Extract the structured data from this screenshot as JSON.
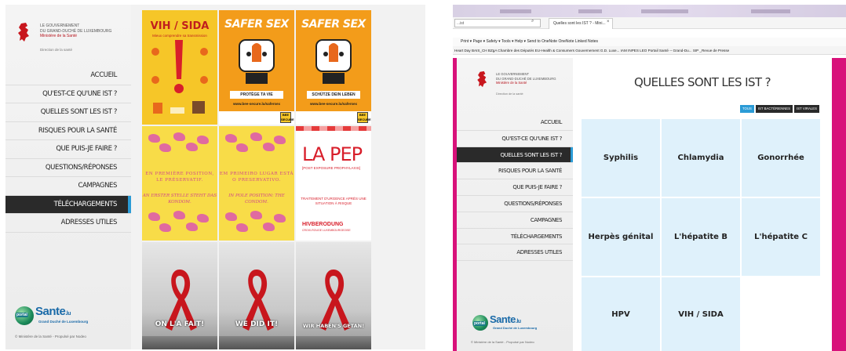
{
  "left": {
    "gov": {
      "line1": "LE GOUVERNEMENT",
      "line2": "DU GRAND-DUCHÉ DE LUXEMBOURG",
      "ministry": "Ministère de la Santé",
      "direction": "Direction de la santé"
    },
    "menu": [
      {
        "label": "ACCUEIL",
        "active": false
      },
      {
        "label": "QU'EST-CE QU'UNE IST ?",
        "active": false
      },
      {
        "label": "QUELLES SONT LES IST ?",
        "active": false
      },
      {
        "label": "RISQUES POUR LA SANTÉ",
        "active": false
      },
      {
        "label": "QUE PUIS-JE FAIRE ?",
        "active": false
      },
      {
        "label": "QUESTIONS/RÉPONSES",
        "active": false
      },
      {
        "label": "CAMPAGNES",
        "active": false
      },
      {
        "label": "TÉLÉCHARGEMENTS",
        "active": true
      },
      {
        "label": "ADRESSES UTILES",
        "active": false
      }
    ],
    "logo": {
      "portal": "portal",
      "name": "Sante",
      "tld": ".lu",
      "sub": "Grand Duché de Luxembourg"
    },
    "copyright": "© Ministère de la Santé - Propulsé par Nodeo",
    "posters": {
      "vih_title": "VIH / SIDA",
      "vih_sub": "Mieux comprendre sa transmission",
      "safer_title": "SAFER SEX",
      "safer1_band": "PROTÈGE TA VIE",
      "safer2_band": "SCHÜTZE DEIN LEBEN",
      "safer_url": "www.bee-secure.lu/safersex",
      "bee": "BEE SECURE",
      "pink1_a": "EN PREMIÈRE POSITION, LE PRÉSERVATIF.",
      "pink1_b": "AN ERSTER STELLE STEHT DAS KONDOM.",
      "pink2_a": "EM PRIMEIRO LUGAR ESTÁ O PRESERVATIVO.",
      "pink2_b": "IN POLE POSITION: THE CONDOM.",
      "pep_title": "LA PEP",
      "pep_sub": "[POST EXPOSURE PROPHYLAXIS]",
      "pep_msg": "TRAITEMENT D'URGENCE APRÈS UNE SITUATION À RISQUE",
      "pep_hb": "HIVBERODUNG",
      "pep_hbs": "CROIX-ROUGE LUXEMBOURGEOISE",
      "rib1": "ON L'A FAIT!",
      "rib2": "WE DID IT!",
      "rib3": "WIR HABEN'S GETAN!"
    }
  },
  "right": {
    "address": "...ist",
    "tab_title": "Quelles sont les IST ? - Mini...",
    "cmd": "Print  ▾  Page ▾  Safety ▾  Tools ▾  Help ▾   Send to OneNote    OneNote Linked Notes",
    "favorites": "Heart Day   BAIS_CH   BZgA   Chambre des Députés   EU-Health & Consumers   Gouvernement G.D. Luxe...   IAM   INPES   LEO   Portail Santé -- Grand-Du...   SIP _Revue de Presse",
    "gov": {
      "line1": "LE GOUVERNEMENT",
      "line2": "DU GRAND-DUCHÉ DE LUXEMBOURG",
      "ministry": "Ministère de la Santé",
      "direction": "Direction de la santé"
    },
    "menu": [
      {
        "label": "ACCUEIL",
        "active": false
      },
      {
        "label": "QU'EST-CE QU'UNE IST ?",
        "active": false
      },
      {
        "label": "QUELLES SONT LES IST ?",
        "active": true
      },
      {
        "label": "RISQUES POUR LA SANTÉ",
        "active": false
      },
      {
        "label": "QUE PUIS-JE FAIRE ?",
        "active": false
      },
      {
        "label": "QUESTIONS/RÉPONSES",
        "active": false
      },
      {
        "label": "CAMPAGNES",
        "active": false
      },
      {
        "label": "TÉLÉCHARGEMENTS",
        "active": false
      },
      {
        "label": "ADRESSES UTILES",
        "active": false
      }
    ],
    "logo": {
      "portal": "portal",
      "name": "Sante",
      "tld": ".lu",
      "sub": "Grand Duché de Luxembourg"
    },
    "copyright": "© Ministère de la Santé - Propulsé par Nodeo",
    "page_title": "QUELLES SONT LES IST ?",
    "filters": [
      {
        "label": "TOUS",
        "on": true
      },
      {
        "label": "IST BACTÉRIENNES",
        "on": false
      },
      {
        "label": "IST VIRALES",
        "on": false
      }
    ],
    "ist": [
      "Syphilis",
      "Chlamydia",
      "Gonorrhée",
      "Herpès génital",
      "L'hépatite B",
      "L'hépatite C",
      "HPV",
      "VIH / SIDA"
    ]
  },
  "colors": {
    "accent_blue": "#2b9bd6",
    "site_pink": "#d8117a",
    "cell_bg": "#dff1fb",
    "active_bg": "#2a2a2a"
  }
}
